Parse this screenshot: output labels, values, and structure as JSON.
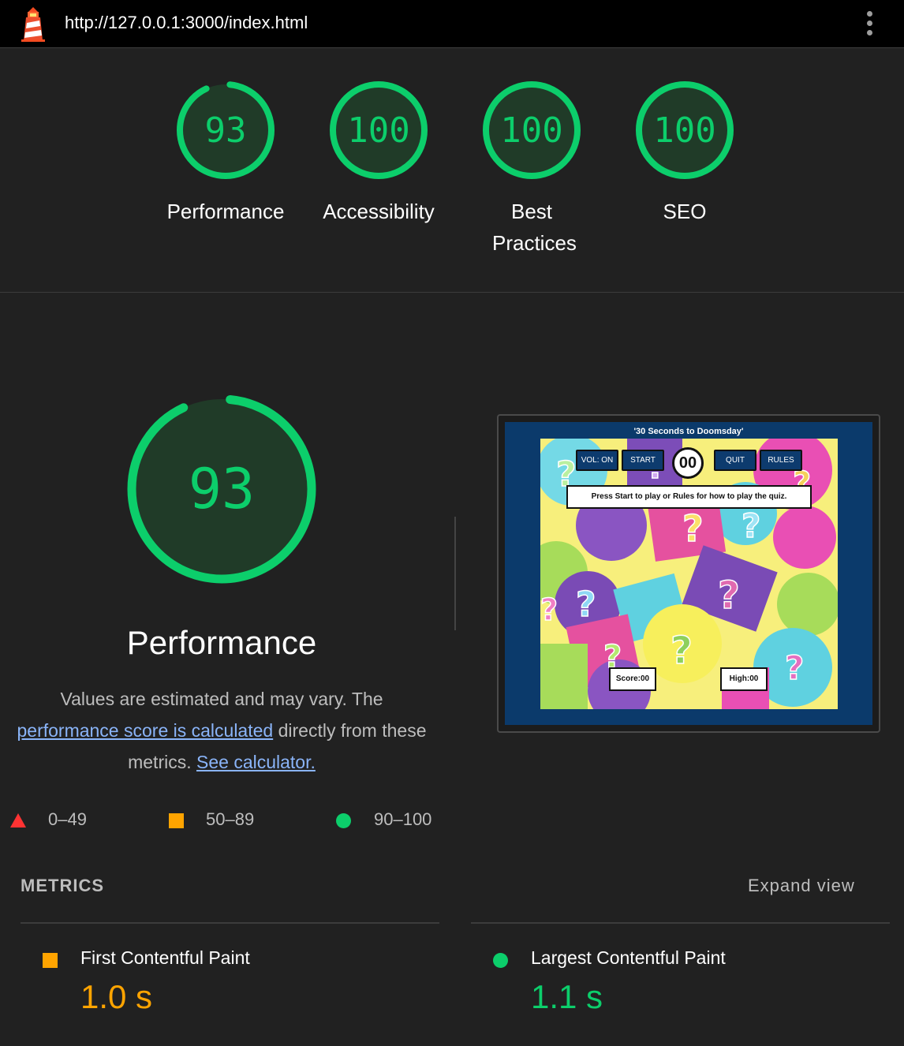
{
  "topbar": {
    "url": "http://127.0.0.1:3000/index.html",
    "logo_icon": "lighthouse-icon",
    "menu_icon": "kebab-menu-icon"
  },
  "categories": [
    {
      "score": "93",
      "label": "Performance",
      "fraction": 0.93
    },
    {
      "score": "100",
      "label": "Accessibility",
      "fraction": 1.0
    },
    {
      "score": "100",
      "label": "Best Practices",
      "fraction": 1.0
    },
    {
      "score": "100",
      "label": "SEO",
      "fraction": 1.0
    }
  ],
  "performance": {
    "score": "93",
    "fraction": 0.93,
    "title": "Performance",
    "desc_1": "Values are estimated and may vary. The ",
    "desc_link_1": "performance score is calculated",
    "desc_2": " directly from these metrics. ",
    "desc_link_2": "See calculator."
  },
  "legend": [
    {
      "range": "0–49",
      "shape": "triangle",
      "color": "#f33"
    },
    {
      "range": "50–89",
      "shape": "square",
      "color": "#ffa400"
    },
    {
      "range": "90–100",
      "shape": "circle",
      "color": "#0cce6b"
    }
  ],
  "screenshot": {
    "title": "'30 Seconds to Doomsday'",
    "btn_vol": "VOL: ON",
    "btn_start": "START",
    "timer": "00",
    "btn_quit": "QUIT",
    "btn_rules": "RULES",
    "message": "Press Start to play or Rules for how to play the quiz.",
    "score": "Score:00",
    "high": "High:00"
  },
  "metrics": {
    "heading": "METRICS",
    "expand": "Expand view",
    "items": [
      {
        "name": "First Contentful Paint",
        "value": "1.0 s",
        "color": "#ffa400"
      },
      {
        "name": "Largest Contentful Paint",
        "value": "1.1 s",
        "color": "#0cce6b"
      }
    ]
  },
  "colors": {
    "pass": "#0cce6b",
    "average": "#ffa400",
    "fail": "#f33",
    "gauge_fill": "#203b28"
  }
}
